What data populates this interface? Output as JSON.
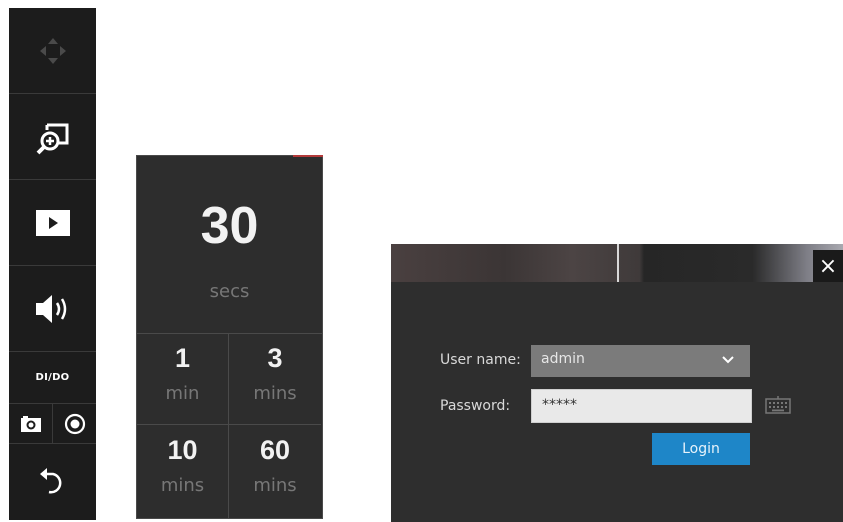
{
  "sidebar": {
    "ptz_icon": "ptz-arrows-icon",
    "zoom_icon": "digital-zoom-icon",
    "play_icon": "play-icon",
    "volume_icon": "volume-icon",
    "dido_label": "DI/DO",
    "snapshot_icon": "camera-icon",
    "record_icon": "record-icon",
    "back_icon": "undo-icon"
  },
  "timeout": {
    "main_value": "30",
    "main_unit": "secs",
    "options": [
      {
        "value": "1",
        "unit": "min"
      },
      {
        "value": "3",
        "unit": "mins"
      },
      {
        "value": "10",
        "unit": "mins"
      },
      {
        "value": "60",
        "unit": "mins"
      }
    ]
  },
  "login": {
    "close_label": "×",
    "username_label": "User name:",
    "username_value": "admin",
    "password_label": "Password:",
    "password_value": "*****",
    "keyboard_icon": "keyboard-icon",
    "login_button": "Login"
  },
  "colors": {
    "sidebar_bg": "#1c1c1c",
    "panel_bg": "#2d2d2d",
    "login_bg": "#2e2e2e",
    "login_button": "#1e86c8"
  }
}
